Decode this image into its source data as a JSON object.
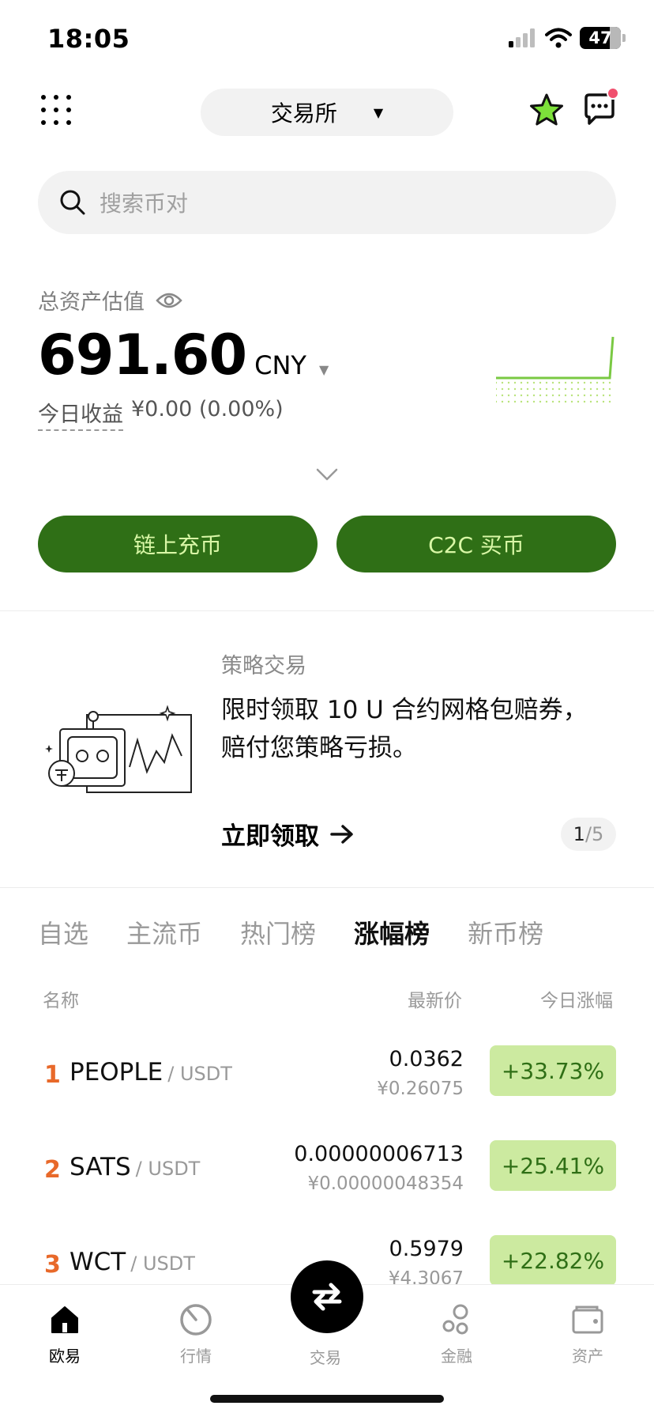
{
  "status_bar": {
    "time": "18:05",
    "battery": "47"
  },
  "header": {
    "exchange_label": "交易所"
  },
  "search": {
    "placeholder": "搜索币对"
  },
  "assets": {
    "label": "总资产估值",
    "value": "691.60",
    "currency": "CNY",
    "pnl_label": "今日收益",
    "pnl_value": "¥0.00 (0.00%)"
  },
  "actions": {
    "deposit_label": "链上充币",
    "c2c_label": "C2C 买币"
  },
  "promo": {
    "tag": "策略交易",
    "text": "限时领取 10 U 合约网格包赔券，赔付您策略亏损。",
    "cta": "立即领取",
    "page_current": "1",
    "page_total": "/5"
  },
  "market_tabs": [
    "自选",
    "主流币",
    "热门榜",
    "涨幅榜",
    "新币榜"
  ],
  "active_tab": "涨幅榜",
  "table_headers": {
    "name": "名称",
    "price": "最新价",
    "change": "今日涨幅"
  },
  "rows": [
    {
      "rank": "1",
      "base": "PEOPLE",
      "quote": "/ USDT",
      "price": "0.0362",
      "price_cny": "¥0.26075",
      "change": "+33.73%"
    },
    {
      "rank": "2",
      "base": "SATS",
      "quote": "/ USDT",
      "price": "0.00000006713",
      "price_cny": "¥0.00000048354",
      "change": "+25.41%"
    },
    {
      "rank": "3",
      "base": "WCT",
      "quote": "/ USDT",
      "price": "0.5979",
      "price_cny": "¥4.3067",
      "change": "+22.82%"
    }
  ],
  "tab_bar": {
    "home": "欧易",
    "markets": "行情",
    "trade": "交易",
    "finance": "金融",
    "assets": "资产"
  },
  "colors": {
    "accent_green": "#2f6f16",
    "badge_green": "#cceaa0",
    "rank_orange": "#e8692a"
  }
}
